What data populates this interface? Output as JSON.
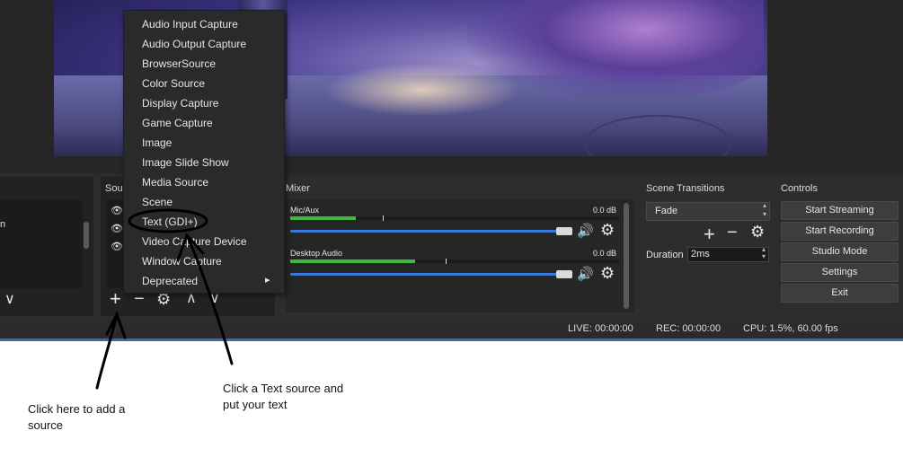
{
  "context_menu": {
    "items": [
      {
        "label": "Audio Input Capture"
      },
      {
        "label": "Audio Output Capture"
      },
      {
        "label": "BrowserSource"
      },
      {
        "label": "Color Source"
      },
      {
        "label": "Display Capture"
      },
      {
        "label": "Game Capture"
      },
      {
        "label": "Image"
      },
      {
        "label": "Image Slide Show"
      },
      {
        "label": "Media Source"
      },
      {
        "label": "Scene"
      },
      {
        "label": "Text (GDI+)"
      },
      {
        "label": "Video Capture Device"
      },
      {
        "label": "Window Capture"
      },
      {
        "label": "Deprecated"
      }
    ],
    "submenu_arrow": "▸"
  },
  "scenes": {
    "partial_text": "n"
  },
  "sources": {
    "title_partial": "Sour"
  },
  "mixer": {
    "title": "Mixer",
    "channels": [
      {
        "name": "Mic/Aux",
        "db": "0.0 dB",
        "level": 0.2,
        "volume": 1.0
      },
      {
        "name": "Desktop Audio",
        "db": "0.0 dB",
        "level": 0.38,
        "volume": 1.0
      }
    ]
  },
  "scene_transitions": {
    "title": "Scene Transitions",
    "transition": "Fade",
    "duration_label": "Duration",
    "duration_value": "2ms"
  },
  "controls": {
    "title": "Controls",
    "buttons": [
      "Start Streaming",
      "Start Recording",
      "Studio Mode",
      "Settings",
      "Exit"
    ]
  },
  "status_bar": {
    "live": "LIVE: 00:00:00",
    "rec": "REC: 00:00:00",
    "cpu": "CPU: 1.5%, 60.00 fps"
  },
  "annotations": {
    "add_source": [
      "Click here to add a",
      "source"
    ],
    "text_source": [
      "Click a Text source and",
      "put your text"
    ]
  },
  "icons": {
    "plus": "+",
    "minus": "−",
    "gear": "⚙",
    "up": "∧",
    "down": "∨",
    "eye": "👁",
    "speaker": "🔊",
    "spin_up": "▴",
    "spin_down": "▾"
  }
}
